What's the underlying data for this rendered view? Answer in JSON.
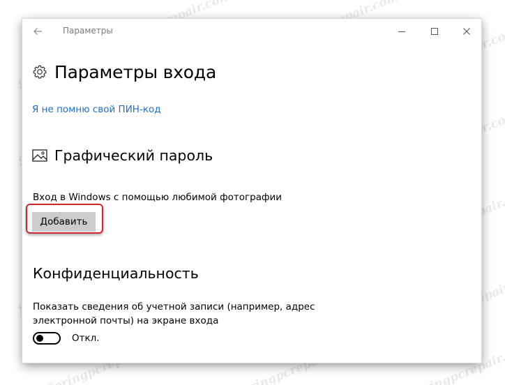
{
  "window": {
    "back_icon": "back-arrow-icon",
    "title": "Параметры",
    "controls": [
      "minimize-icon",
      "maximize-icon",
      "close-icon"
    ]
  },
  "page": {
    "icon": "gear-icon",
    "title": "Параметры входа"
  },
  "pin": {
    "forgot_link": "Я не помню свой ПИН-код"
  },
  "picture_password": {
    "icon": "picture-icon",
    "title": "Графический пароль",
    "description": "Вход в Windows с помощью любимой фотографии",
    "add_button": "Добавить",
    "highlight_color": "#d3262c"
  },
  "privacy": {
    "title": "Конфиденциальность",
    "description": "Показать сведения об учетной записи (например, адрес электронной почты) на экране входа",
    "toggle_state": "Откл."
  },
  "watermark": "Soringpcrepair.com",
  "colors": {
    "link": "#1f6fc6",
    "button_bg": "#cccccc"
  }
}
